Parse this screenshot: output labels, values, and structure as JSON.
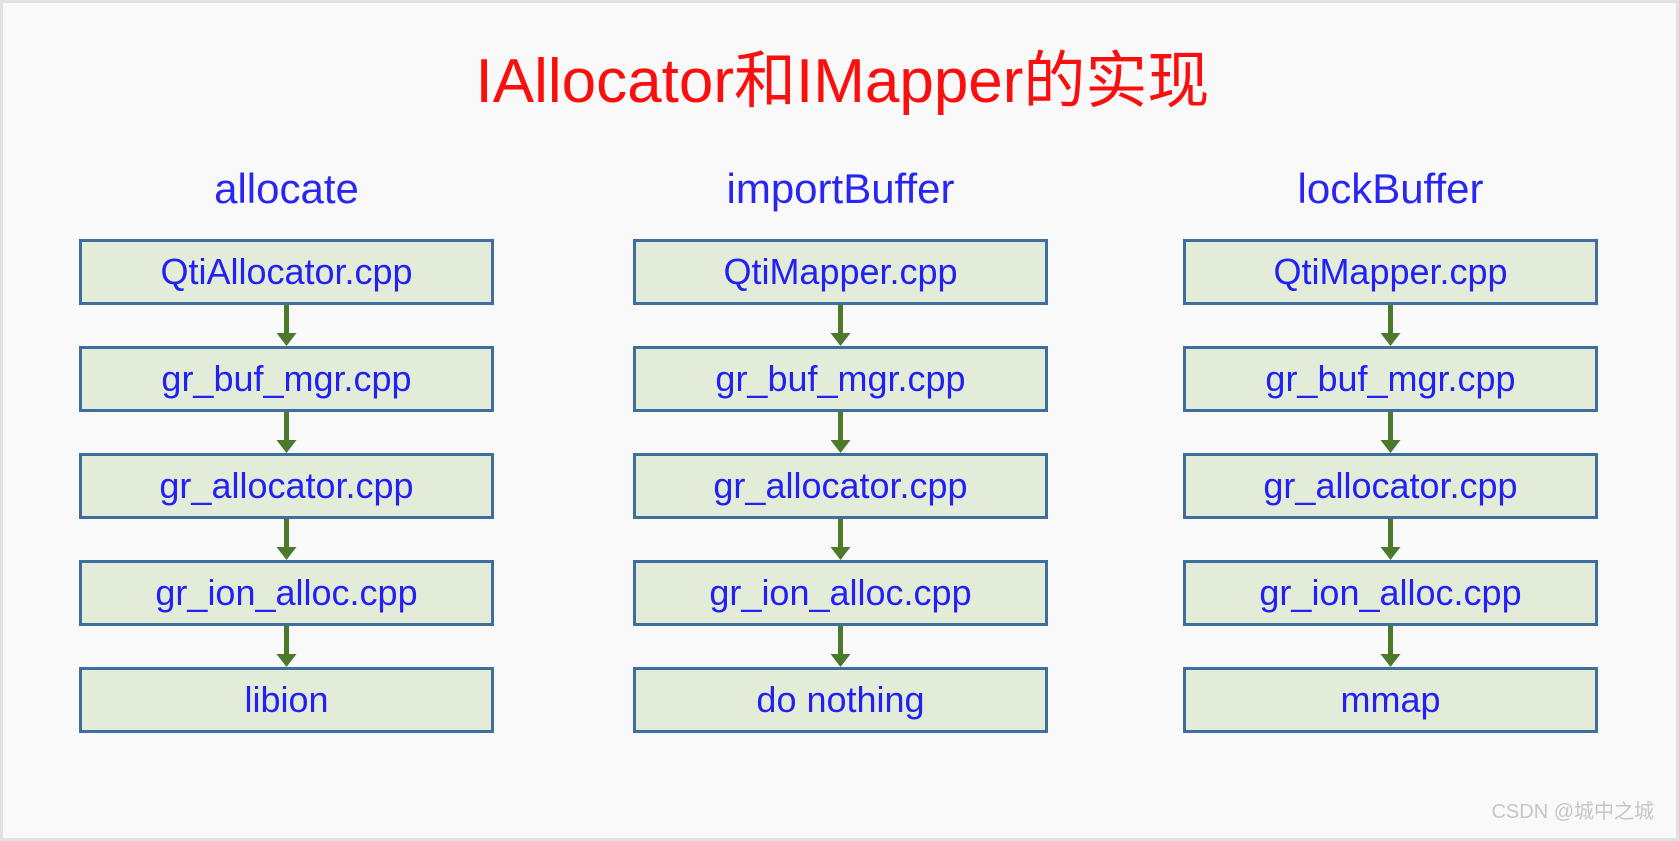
{
  "page": {
    "title": "IAllocator和IMapper的实现",
    "background_color": "#f9f9f9",
    "border_color": "#e1e1e1"
  },
  "theme": {
    "title_color": "#fa0f0f",
    "header_color": "#2a26f2",
    "node_text_color": "#2121f5",
    "node_fill_color": "#e3ecd8",
    "node_border_color": "#3d6e9e",
    "arrow_color": "#4d7a2a"
  },
  "columns": [
    {
      "id": "allocate",
      "header": "allocate",
      "nodes": [
        {
          "label": "QtiAllocator.cpp"
        },
        {
          "label": "gr_buf_mgr.cpp"
        },
        {
          "label": "gr_allocator.cpp"
        },
        {
          "label": "gr_ion_alloc.cpp"
        },
        {
          "label": "libion"
        }
      ]
    },
    {
      "id": "importbuffer",
      "header": "importBuffer",
      "nodes": [
        {
          "label": "QtiMapper.cpp"
        },
        {
          "label": "gr_buf_mgr.cpp"
        },
        {
          "label": "gr_allocator.cpp"
        },
        {
          "label": "gr_ion_alloc.cpp"
        },
        {
          "label": "do nothing"
        }
      ]
    },
    {
      "id": "lockbuffer",
      "header": "lockBuffer",
      "nodes": [
        {
          "label": "QtiMapper.cpp"
        },
        {
          "label": "gr_buf_mgr.cpp"
        },
        {
          "label": "gr_allocator.cpp"
        },
        {
          "label": "gr_ion_alloc.cpp"
        },
        {
          "label": "mmap"
        }
      ]
    }
  ],
  "watermark": {
    "text": "CSDN @城中之城"
  }
}
